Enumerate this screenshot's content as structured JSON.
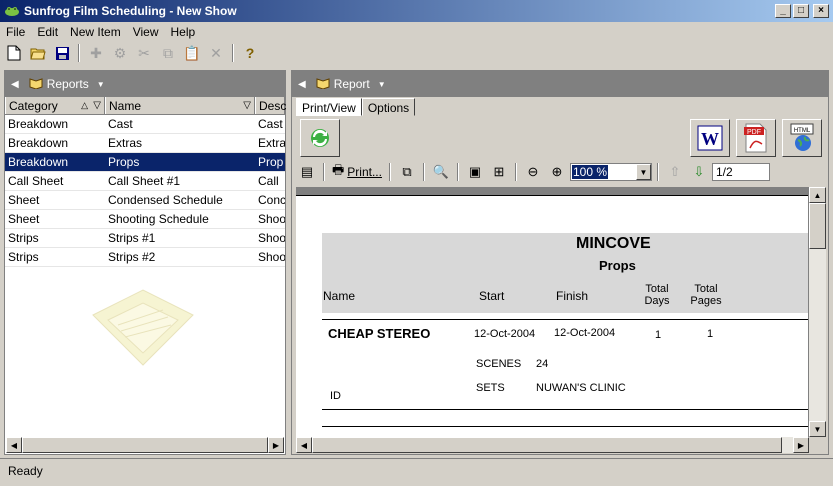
{
  "window": {
    "title": "Sunfrog Film Scheduling - New Show",
    "minimize": "_",
    "maximize": "□",
    "close": "×"
  },
  "menu": [
    "File",
    "Edit",
    "New Item",
    "View",
    "Help"
  ],
  "left_pane": {
    "header_label": "Reports",
    "columns": [
      "Category",
      "Name",
      "Desc"
    ],
    "rows": [
      {
        "category": "Breakdown",
        "name": "Cast",
        "desc": "Cast"
      },
      {
        "category": "Breakdown",
        "name": "Extras",
        "desc": "Extra"
      },
      {
        "category": "Breakdown",
        "name": "Props",
        "desc": "Prop"
      },
      {
        "category": "Call Sheet",
        "name": "Call Sheet #1",
        "desc": "Call"
      },
      {
        "category": "Sheet",
        "name": "Condensed Schedule",
        "desc": "Conc"
      },
      {
        "category": "Sheet",
        "name": "Shooting Schedule",
        "desc": "Shoo"
      },
      {
        "category": "Strips",
        "name": "Strips #1",
        "desc": "Shoo"
      },
      {
        "category": "Strips",
        "name": "Strips #2",
        "desc": "Shoo"
      }
    ],
    "selected_row": 2
  },
  "right_pane": {
    "header_label": "Report",
    "tabs": [
      "Print/View",
      "Options"
    ],
    "active_tab": 0,
    "print_label": "Print...",
    "zoom": "100 %",
    "page": "1/2"
  },
  "report": {
    "title": "MINCOVE",
    "subtitle": "Props",
    "col_name": "Name",
    "col_start": "Start",
    "col_finish": "Finish",
    "col_total_days_1": "Total",
    "col_total_days_2": "Days",
    "col_total_pages_1": "Total",
    "col_total_pages_2": "Pages",
    "item_name": "CHEAP STEREO",
    "item_start": "12-Oct-2004",
    "item_finish": "12-Oct-2004",
    "item_days": "1",
    "item_pages": "1",
    "scenes_label": "SCENES",
    "scenes_value": "24",
    "sets_label": "SETS",
    "sets_value": "NUWAN'S CLINIC",
    "id_label": "ID"
  },
  "status": "Ready",
  "colors": {
    "selection": "#0a246a",
    "titlebar": "#0a246a",
    "face": "#d4d0c8"
  }
}
